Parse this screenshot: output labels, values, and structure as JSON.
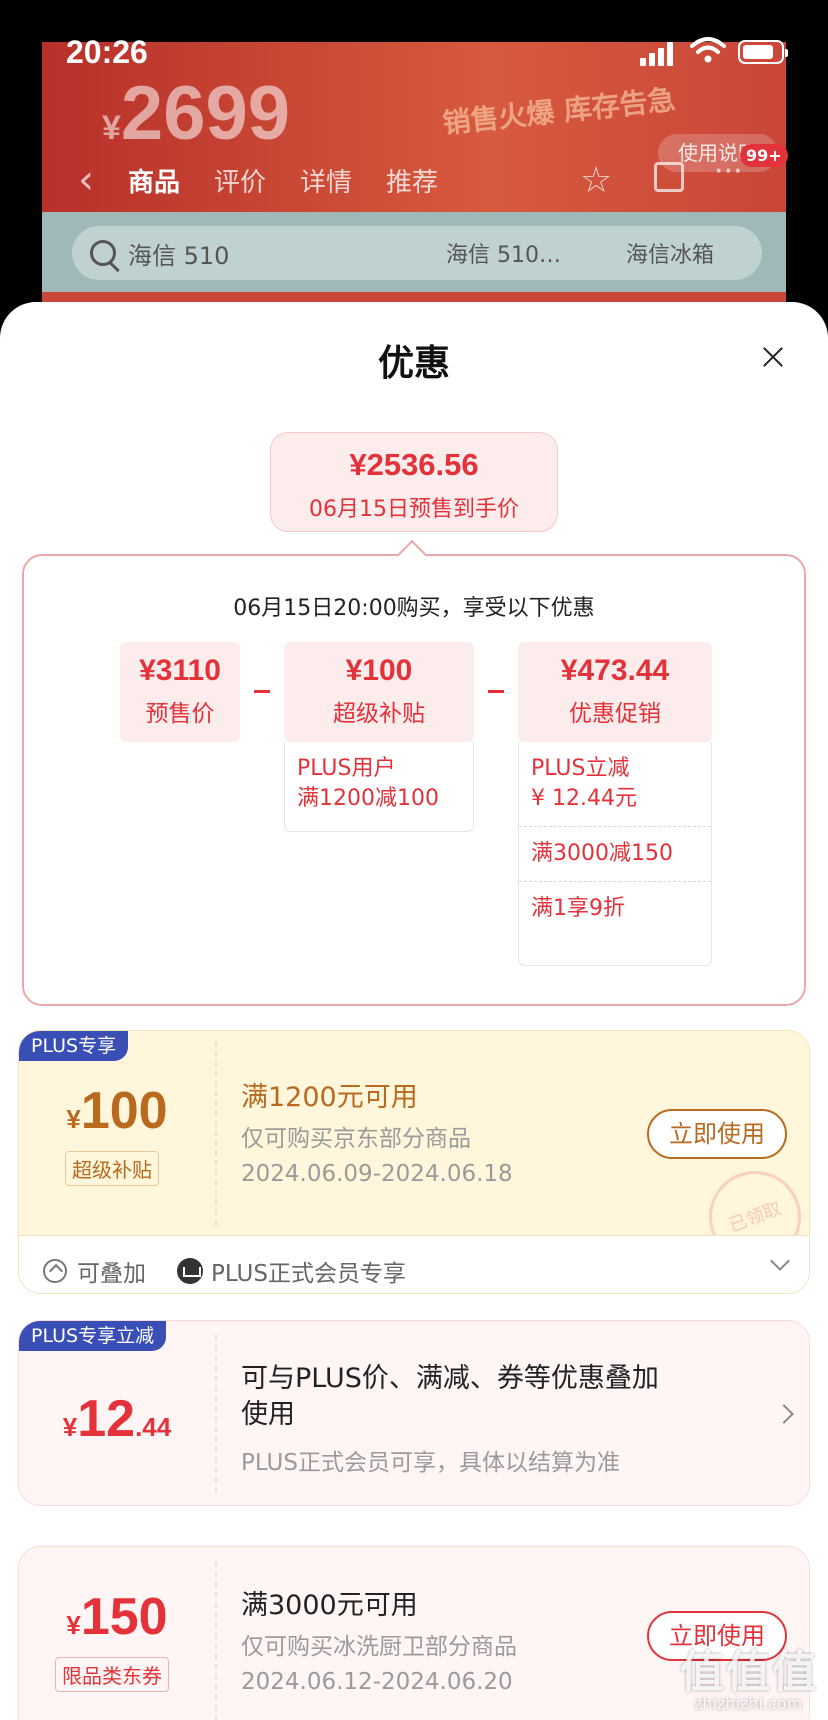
{
  "status_bar": {
    "time": "20:26"
  },
  "background": {
    "price": "2699",
    "price_yen": "¥",
    "promo": "销售火爆 库存告急",
    "nav_tabs": [
      "商品",
      "评价",
      "详情",
      "推荐"
    ],
    "help_label": "使用说明",
    "badge": "99+",
    "search_query": "海信 510",
    "search_hints": [
      "海信 510…",
      "海信冰箱"
    ]
  },
  "sheet": {
    "title": "优惠",
    "final": {
      "price": "¥2536.56",
      "label": "06月15日预售到手价"
    },
    "calc": {
      "title": "06月15日20:00购买，享受以下优惠",
      "presale": {
        "value": "¥3110",
        "label": "预售价"
      },
      "subsidy": {
        "value": "¥100",
        "label": "超级补贴",
        "details": [
          "PLUS用户",
          "满1200减100"
        ]
      },
      "promotion": {
        "value": "¥473.44",
        "label": "优惠促销",
        "details": [
          "PLUS立减",
          "¥ 12.44元",
          "满3000减150",
          "满1享9折"
        ]
      }
    },
    "coupons": [
      {
        "tag": "PLUS专享",
        "yen": "¥",
        "amount": "100",
        "sub_label": "超级补贴",
        "title": "满1200元可用",
        "desc": "仅可购买京东部分商品",
        "date": "2024.06.09-2024.06.18",
        "button": "立即使用",
        "stamp": "已领取",
        "footer": {
          "stackable": "可叠加",
          "member": "PLUS正式会员专享"
        }
      },
      {
        "tag": "PLUS专享立减",
        "yen": "¥",
        "amount": "12",
        "amount_dec": ".44",
        "title_line1": "可与PLUS价、满减、券等优惠叠加",
        "title_line2": "使用",
        "desc": "PLUS正式会员可享，具体以结算为准"
      },
      {
        "yen": "¥",
        "amount": "150",
        "sub_label": "限品类东券",
        "title": "满3000元可用",
        "desc": "仅可购买冰洗厨卫部分商品",
        "date": "2024.06.12-2024.06.20",
        "button": "立即使用"
      }
    ]
  },
  "watermark": {
    "text": "值值值",
    "url": "zhizhizhi.com"
  },
  "colors": {
    "accent": "#e3323a",
    "gold": "#b86a1f",
    "plus_blue": "#3a4fb5"
  }
}
